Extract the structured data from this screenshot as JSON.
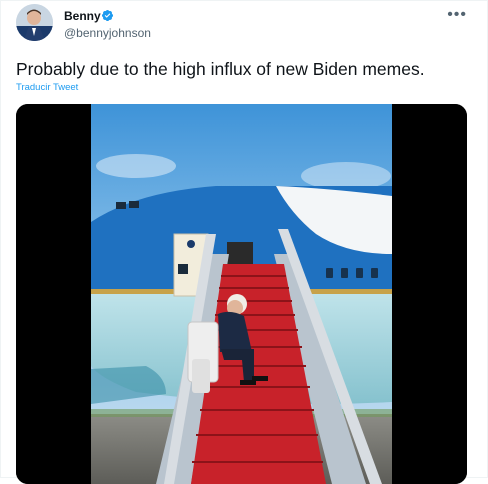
{
  "author": {
    "name": "Benny",
    "handle": "@bennyjohnson",
    "verified": true
  },
  "tweet": {
    "text": "Probably due to the high influx of new Biden memes.",
    "translate_label": "Traducir Tweet"
  },
  "more_glyph": "•••",
  "icons": {
    "avatar": "profile-photo",
    "verified": "verified-badge-icon",
    "more": "more-options-icon",
    "media": "video-still-stairs-airplane"
  },
  "colors": {
    "link": "#1d9bf0",
    "secondary_text": "#536471",
    "carpet": "#c8222a",
    "plane_blue": "#1f71c0"
  }
}
